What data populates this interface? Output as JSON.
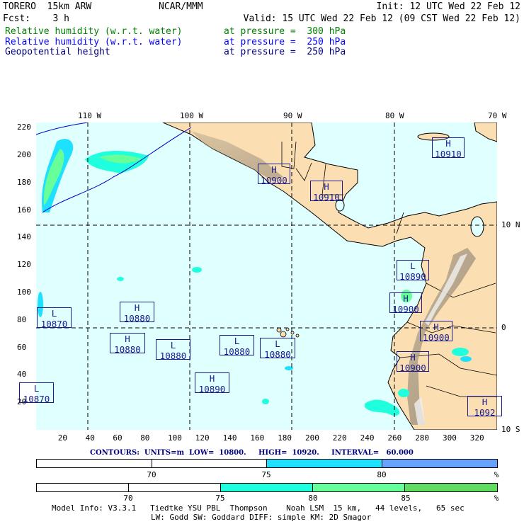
{
  "header": {
    "model": "TORERO  15km ARW",
    "org": "NCAR/MMM",
    "init": "Init: 12 UTC Wed 22 Feb 12",
    "fcst": "Fcst:    3 h",
    "valid": "Valid: 15 UTC Wed 22 Feb 12 (09 CST Wed 22 Feb 12)",
    "fields": [
      {
        "name": "Relative humidity (w.r.t. water)",
        "level": "at pressure =  300 hPa",
        "color": "#008000"
      },
      {
        "name": "Relative humidity (w.r.t. water)",
        "level": "at pressure =  250 hPa",
        "color": "#0000ff"
      },
      {
        "name": "Geopotential height",
        "level": "at pressure =  250 hPa",
        "color": "#000080"
      }
    ]
  },
  "map": {
    "lon_labels": [
      "110 W",
      "100 W",
      "90 W",
      "80 W",
      "70 W"
    ],
    "lat_labels": [
      "10 N",
      "0",
      "10 S"
    ],
    "y_ticks": [
      "220",
      "200",
      "180",
      "160",
      "140",
      "120",
      "100",
      "80",
      "60",
      "40",
      "20"
    ],
    "x_ticks": [
      "20",
      "40",
      "60",
      "80",
      "100",
      "120",
      "140",
      "160",
      "180",
      "200",
      "220",
      "240",
      "260",
      "280",
      "300",
      "320"
    ],
    "colors": {
      "ocean": "#e0ffff",
      "land": "#fbdfb3",
      "mountain": "#8a7f70"
    },
    "centers": [
      {
        "type": "H",
        "value": "10910"
      },
      {
        "type": "H",
        "value": "10900"
      },
      {
        "type": "H",
        "value": "10910"
      },
      {
        "type": "L",
        "value": "10890"
      },
      {
        "type": "H",
        "value": "10900"
      },
      {
        "type": "H",
        "value": "10900"
      },
      {
        "type": "H",
        "value": "10900"
      },
      {
        "type": "L",
        "value": "10870"
      },
      {
        "type": "H",
        "value": "10880"
      },
      {
        "type": "H",
        "value": "10880"
      },
      {
        "type": "L",
        "value": "10880"
      },
      {
        "type": "L",
        "value": "10880"
      },
      {
        "type": "L",
        "value": "10880"
      },
      {
        "type": "H",
        "value": "10890"
      },
      {
        "type": "L",
        "value": "10870"
      },
      {
        "type": "H",
        "value": "1092"
      }
    ]
  },
  "contours": "CONTOURS:  UNITS=m  LOW=  10800.     HIGH=  10920.     INTERVAL=   60.000",
  "colorbar_250": {
    "labels": [
      "70",
      "75",
      "80",
      "%"
    ],
    "colors": [
      "#ffffff",
      "#ffffff",
      "#1ee0ff",
      "#66a3ff"
    ]
  },
  "colorbar_300": {
    "labels": [
      "70",
      "75",
      "80",
      "85",
      "%"
    ],
    "colors": [
      "#ffffff",
      "#ffffff",
      "#20ffdd",
      "#66ff99",
      "#60dd60"
    ]
  },
  "footer": {
    "line1": "Model Info: V3.3.1   Tiedtke YSU PBL  Thompson    Noah LSM  15 km,   44 levels,   65 sec",
    "line2": "LW: Godd SW: Goddard DIFF: simple KM: 2D Smagor"
  }
}
